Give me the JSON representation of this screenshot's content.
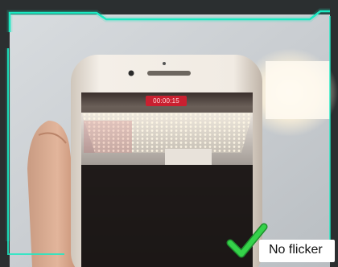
{
  "caption": "No flicker",
  "recording_timer": "00:00:15",
  "icons": {
    "check": "check-mark-icon"
  },
  "colors": {
    "frame_accent": "#1de9c3",
    "check": "#35d24a",
    "timer_bg": "#c92030"
  }
}
